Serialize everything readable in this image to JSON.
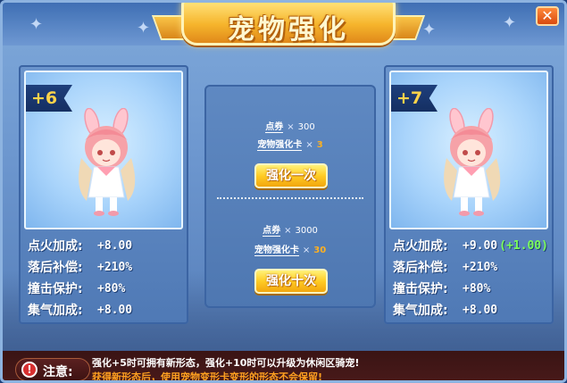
{
  "window": {
    "title": "宠物强化",
    "close_label": "✕"
  },
  "left_pet": {
    "level": "+6",
    "stats": [
      {
        "label": "点火加成:",
        "value": "+8.00",
        "bonus": ""
      },
      {
        "label": "落后补偿:",
        "value": "+210%",
        "bonus": ""
      },
      {
        "label": "撞击保护:",
        "value": "+80%",
        "bonus": ""
      },
      {
        "label": "集气加成:",
        "value": "+8.00",
        "bonus": ""
      }
    ]
  },
  "right_pet": {
    "level": "+7",
    "stats": [
      {
        "label": "点火加成:",
        "value": "+9.00",
        "bonus": "(+1.00)"
      },
      {
        "label": "落后补偿:",
        "value": "+210%",
        "bonus": ""
      },
      {
        "label": "撞击保护:",
        "value": "+80%",
        "bonus": ""
      },
      {
        "label": "集气加成:",
        "value": "+8.00",
        "bonus": ""
      }
    ]
  },
  "enhance_once": {
    "cost_1_name": "点券",
    "cost_1_qty": "300",
    "cost_2_name": "宠物强化卡",
    "cost_2_qty": "3",
    "button_label": "强化一次"
  },
  "enhance_ten": {
    "cost_1_name": "点券",
    "cost_1_qty": "3000",
    "cost_2_name": "宠物强化卡",
    "cost_2_qty": "30",
    "button_label": "强化十次"
  },
  "notice": {
    "label": "注意:",
    "icon": "!",
    "line_1": "强化+5时可拥有新形态，强化+10时可以升级为休闲区骑宠!",
    "line_2": "获得新形态后，使用宠物变形卡变形的形态不会保留!"
  },
  "multiply_sign": "×",
  "colors": {
    "accent_gold": "#ffcc24",
    "bonus_green": "#7cff5a",
    "warning_orange": "#ffa020"
  },
  "icons": [
    "close-icon",
    "alert-icon",
    "star-icon",
    "pet-bunny-icon"
  ]
}
